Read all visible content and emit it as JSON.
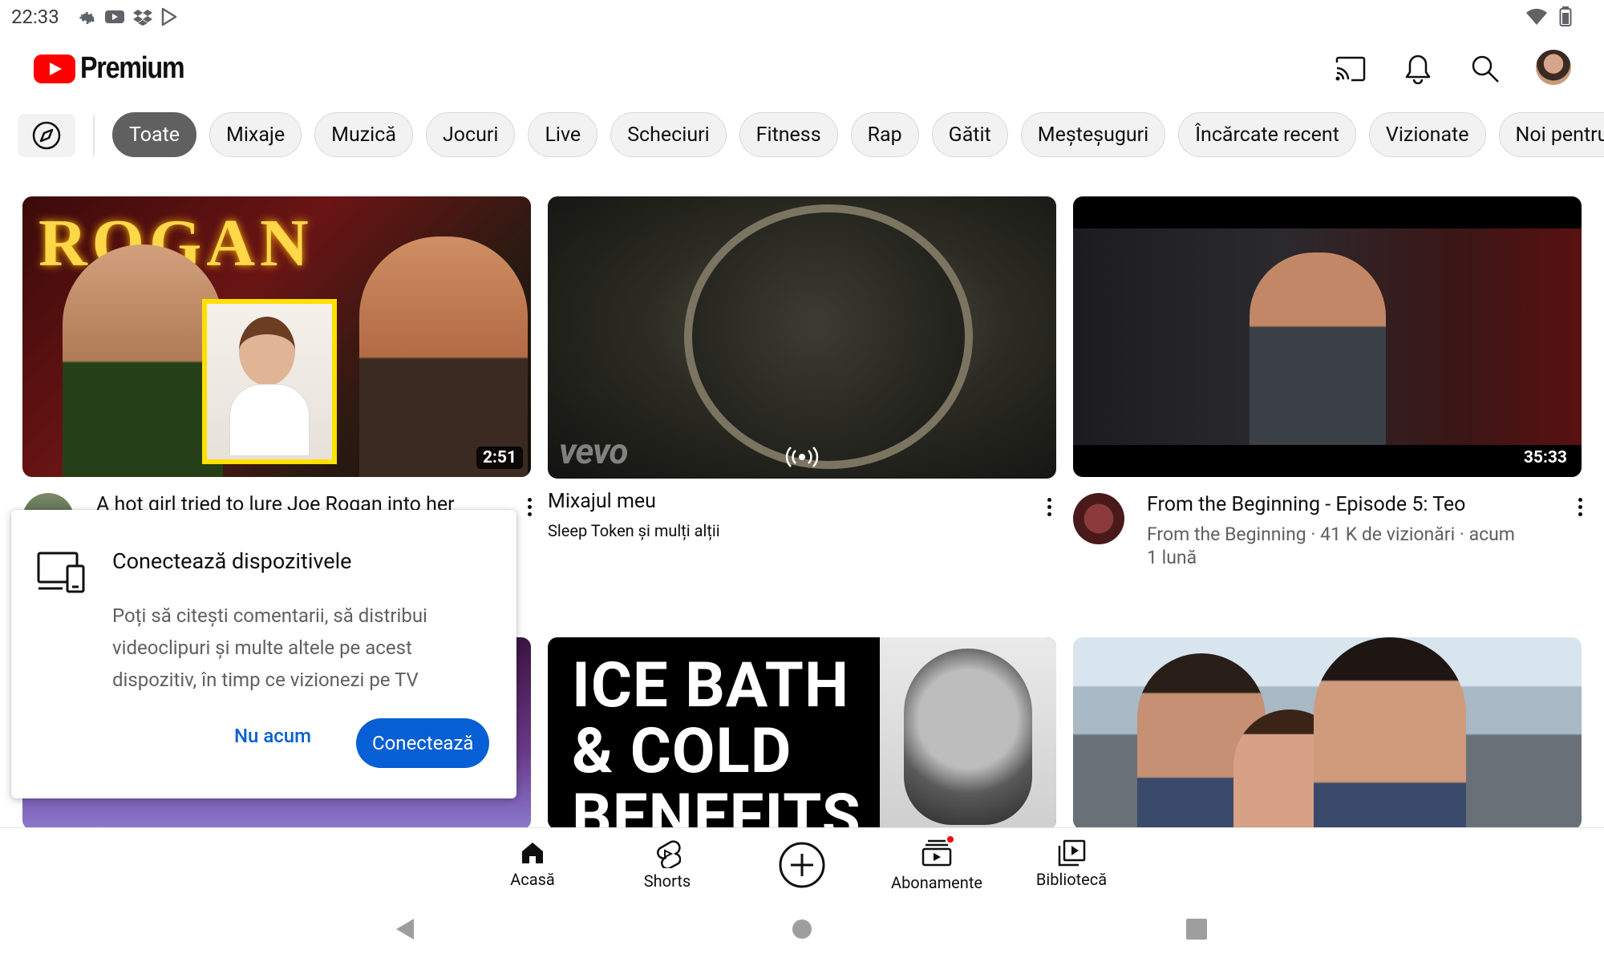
{
  "status_bar": {
    "time": "22:33"
  },
  "header": {
    "logo_text": "Premium"
  },
  "chips": [
    {
      "label": "Toate",
      "active": true
    },
    {
      "label": "Mixaje"
    },
    {
      "label": "Muzică"
    },
    {
      "label": "Jocuri"
    },
    {
      "label": "Live"
    },
    {
      "label": "Scheciuri"
    },
    {
      "label": "Fitness"
    },
    {
      "label": "Rap"
    },
    {
      "label": "Gătit"
    },
    {
      "label": "Meșteșuguri"
    },
    {
      "label": "Încărcate recent"
    },
    {
      "label": "Vizionate"
    },
    {
      "label": "Noi pentru tine"
    }
  ],
  "videos": [
    {
      "title": "A hot girl tried to lure Joe Rogan into her",
      "duration": "2:51",
      "thumb_text": "ROGAN"
    },
    {
      "title": "Mixajul meu",
      "subtitle": "Sleep Token și mulți alții",
      "thumb_watermark": "vevo"
    },
    {
      "title": "From the Beginning - Episode 5: Teo",
      "meta_line1": "From the Beginning · 41 K de vizionări · acum",
      "meta_line2": "1 lună",
      "duration": "35:33"
    },
    {
      "thumb_text": "ICE BATH & COLD BENEFITS"
    }
  ],
  "popup": {
    "title": "Conectează dispozitivele",
    "body": "Poți să citești comentarii, să distribui videoclipuri și multe altele pe acest dispozitiv, în timp ce vizionezi pe TV",
    "secondary_button": "Nu acum",
    "primary_button": "Conectează"
  },
  "bottom_nav": {
    "home": "Acasă",
    "shorts": "Shorts",
    "subscriptions": "Abonamente",
    "library": "Bibliotecă"
  },
  "colors": {
    "brand_red": "#ff0000",
    "accent_blue": "#065fd4",
    "active_chip": "#606060"
  }
}
